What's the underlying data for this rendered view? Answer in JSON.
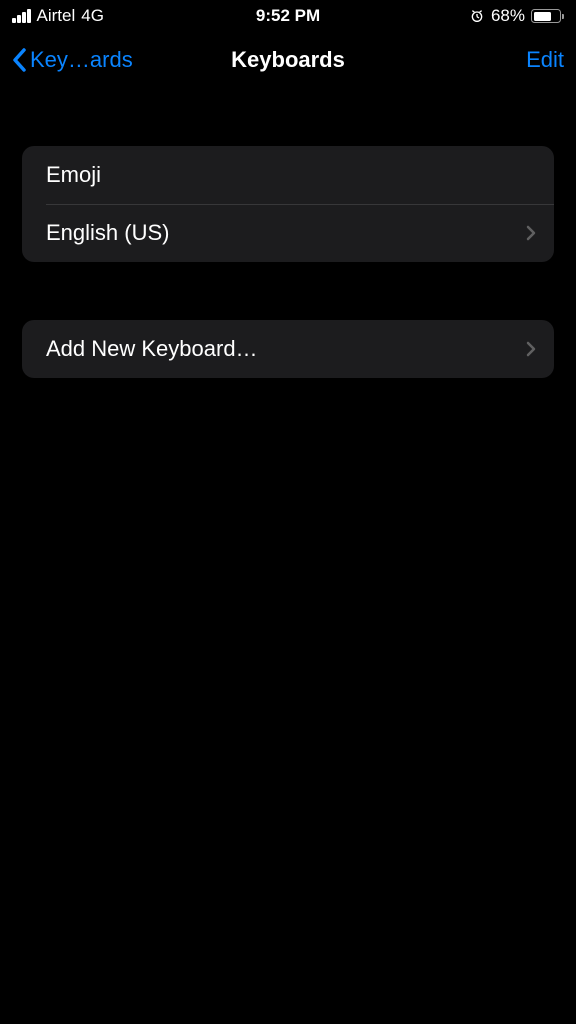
{
  "statusBar": {
    "carrier": "Airtel",
    "network": "4G",
    "time": "9:52 PM",
    "batteryText": "68%"
  },
  "navBar": {
    "backLabel": "Key…ards",
    "title": "Keyboards",
    "editLabel": "Edit"
  },
  "keyboards": {
    "items": [
      {
        "label": "Emoji",
        "hasChevron": false
      },
      {
        "label": "English (US)",
        "hasChevron": true
      }
    ]
  },
  "addAction": {
    "label": "Add New Keyboard…"
  }
}
